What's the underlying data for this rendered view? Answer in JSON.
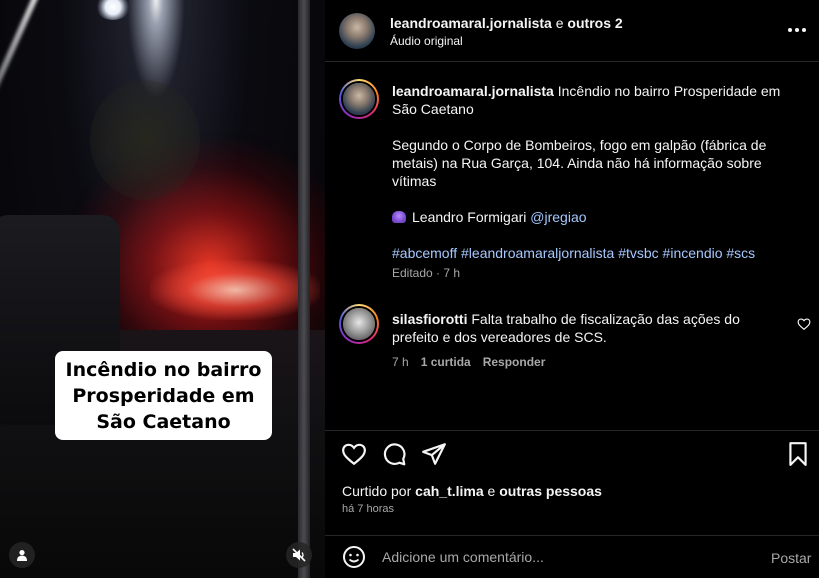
{
  "media": {
    "overlay_text": "Incêndio no bairro\nProsperidade em\nSão Caetano"
  },
  "header": {
    "username": "leandroamaral.jornalista",
    "separator": "e",
    "others": "outros 2",
    "audio": "Áudio original"
  },
  "caption": {
    "username": "leandroamaral.jornalista",
    "title": "Incêndio no bairro Prosperidade em São Caetano",
    "body": "Segundo o Corpo de Bombeiros, fogo em galpão (fábrica de metais) na Rua Garça, 104. Ainda não há informação sobre vítimas",
    "credit_name": "Leandro Formigari",
    "credit_handle": "@jregiao",
    "hashtags": "#abcemoff #leandroamaraljornalista #tvsbc #incendio #scs",
    "meta": "Editado · 7 h"
  },
  "comment": {
    "username": "silasfiorotti",
    "text": "Falta trabalho de fiscalização das ações do prefeito e dos vereadores de SCS.",
    "time": "7 h",
    "likes": "1 curtida",
    "reply": "Responder"
  },
  "likes": {
    "prefix": "Curtido por",
    "user": "cah_t.lima",
    "and": "e",
    "others": "outras pessoas"
  },
  "time_ago": "há 7 horas",
  "comment_box": {
    "placeholder": "Adicione um comentário...",
    "post_label": "Postar"
  }
}
